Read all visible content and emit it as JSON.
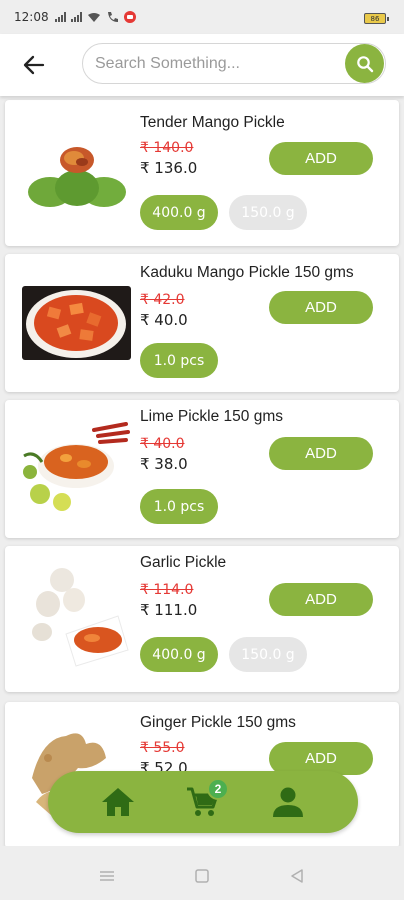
{
  "status_bar": {
    "time": "12:08",
    "battery": "86"
  },
  "header": {
    "search_placeholder": "Search Something..."
  },
  "products": [
    {
      "name": "Tender Mango Pickle",
      "old_price": "₹ 140.0",
      "new_price": "₹ 136.0",
      "add_label": "ADD",
      "variants": [
        {
          "label": "400.0 g",
          "selected": true
        },
        {
          "label": "150.0 g",
          "selected": false
        }
      ]
    },
    {
      "name": "Kaduku Mango Pickle 150 gms",
      "old_price": "₹ 42.0",
      "new_price": "₹ 40.0",
      "add_label": "ADD",
      "variants": [
        {
          "label": "1.0 pcs",
          "selected": true
        }
      ]
    },
    {
      "name": "Lime Pickle 150 gms",
      "old_price": "₹ 40.0",
      "new_price": "₹ 38.0",
      "add_label": "ADD",
      "variants": [
        {
          "label": "1.0 pcs",
          "selected": true
        }
      ]
    },
    {
      "name": "Garlic Pickle",
      "old_price": "₹ 114.0",
      "new_price": "₹ 111.0",
      "add_label": "ADD",
      "variants": [
        {
          "label": "400.0 g",
          "selected": true
        },
        {
          "label": "150.0 g",
          "selected": false
        }
      ]
    },
    {
      "name": "Ginger Pickle 150 gms",
      "old_price": "₹ 55.0",
      "new_price": "₹ 52.0",
      "add_label": "ADD",
      "variants": []
    }
  ],
  "bottom_nav": {
    "cart_count": "2",
    "items": [
      "home-icon",
      "cart-icon",
      "profile-icon"
    ]
  },
  "colors": {
    "accent": "#8bb440",
    "price_old": "#e53935",
    "badge": "#4caf50",
    "disabled": "#e6e6e6"
  }
}
